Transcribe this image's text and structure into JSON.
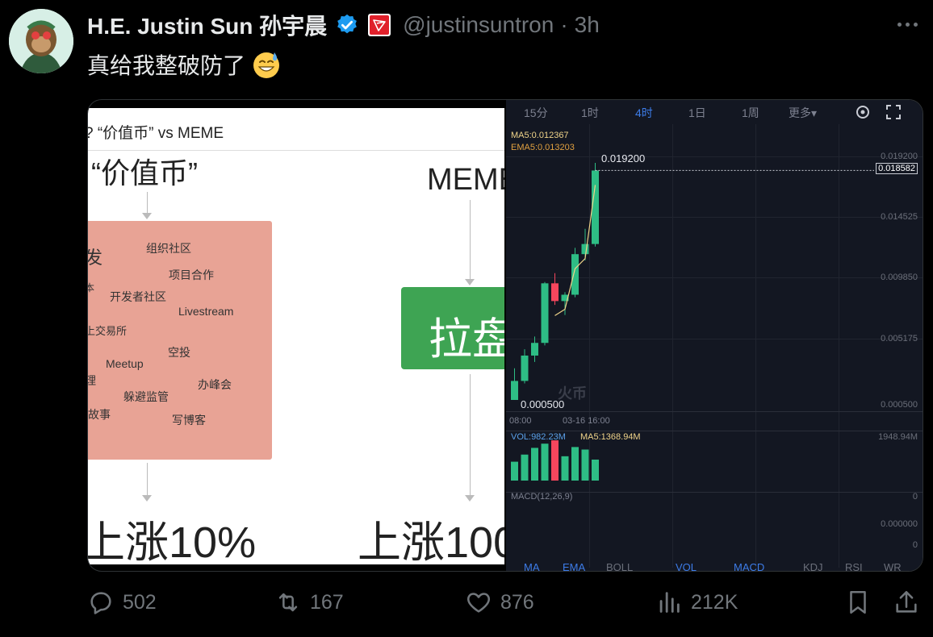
{
  "tweet": {
    "author_name": "H.E. Justin Sun 孙宇晨",
    "handle": "@justinsuntron",
    "separator": "·",
    "time": "3h",
    "text": "真给我整破防了",
    "emoji_icon": "grinning-sweat-emoji-icon"
  },
  "left_image": {
    "header": "? “价值币” vs MEME",
    "value_coin_title": "“价值币”",
    "meme_title": "MEME",
    "keywords": [
      "发",
      "组织社区",
      "项目合作",
      "本",
      "开发者社区",
      "Livestream",
      "上交易所",
      "空投",
      "Meetup",
      "理",
      "办峰会",
      "躲避监管",
      "故事",
      "写博客"
    ],
    "green_box_label": "拉盘",
    "rise_left": "上涨10%",
    "rise_right": "上涨100"
  },
  "chart_panel": {
    "tabs": [
      "15分",
      "1时",
      "4时",
      "1日",
      "1周",
      "更多▾"
    ],
    "active_tab": "4时",
    "ma5": "MA5:0.012367",
    "ema5": "EMA5:0.013203",
    "high_label": "0.019200",
    "low_label": "0.000500",
    "current_price": "0.018582",
    "watermark": "火币",
    "x_labels": [
      "08:00",
      "03-16 16:00"
    ],
    "vol_label": "VOL:982.23M",
    "vol_ma5": "MA5:1368.94M",
    "vol_max": "1948.94M",
    "macd_label": "MACD(12,26,9)",
    "macd_ticks": [
      "0",
      "0.000000",
      "0"
    ],
    "bottom_tabs": [
      "MA",
      "EMA",
      "BOLL",
      "VOL",
      "MACD",
      "KDJ",
      "RSI",
      "WR"
    ],
    "colors": {
      "up": "#2ebd85",
      "down": "#f6465d",
      "ma": "#f0d48a",
      "accent": "#3d7ce8"
    }
  },
  "chart_data": {
    "type": "candlestick",
    "y_ticks": [
      "0.019200",
      "0.014525",
      "0.009850",
      "0.005175",
      "0.000500"
    ],
    "y_range": [
      0.0005,
      0.0192
    ],
    "candles": [
      {
        "o": 0.0005,
        "h": 0.003,
        "l": 0.0005,
        "c": 0.002,
        "up": true
      },
      {
        "o": 0.002,
        "h": 0.0045,
        "l": 0.0018,
        "c": 0.004,
        "up": true
      },
      {
        "o": 0.004,
        "h": 0.0055,
        "l": 0.0035,
        "c": 0.005,
        "up": true
      },
      {
        "o": 0.005,
        "h": 0.0098,
        "l": 0.0048,
        "c": 0.0097,
        "up": true
      },
      {
        "o": 0.0097,
        "h": 0.0105,
        "l": 0.008,
        "c": 0.0083,
        "up": false
      },
      {
        "o": 0.0083,
        "h": 0.009,
        "l": 0.0072,
        "c": 0.0088,
        "up": true
      },
      {
        "o": 0.0088,
        "h": 0.0125,
        "l": 0.0086,
        "c": 0.012,
        "up": true
      },
      {
        "o": 0.012,
        "h": 0.014,
        "l": 0.0115,
        "c": 0.0128,
        "up": true
      },
      {
        "o": 0.0128,
        "h": 0.0192,
        "l": 0.0126,
        "c": 0.0186,
        "up": true
      }
    ],
    "volume": [
      {
        "v": 0.45,
        "up": true
      },
      {
        "v": 0.62,
        "up": true
      },
      {
        "v": 0.78,
        "up": true
      },
      {
        "v": 0.88,
        "up": true
      },
      {
        "v": 0.96,
        "up": false
      },
      {
        "v": 0.58,
        "up": true
      },
      {
        "v": 0.8,
        "up": true
      },
      {
        "v": 0.74,
        "up": true
      },
      {
        "v": 0.5,
        "up": true
      }
    ]
  },
  "actions": {
    "replies": "502",
    "retweets": "167",
    "likes": "876",
    "views": "212K"
  }
}
